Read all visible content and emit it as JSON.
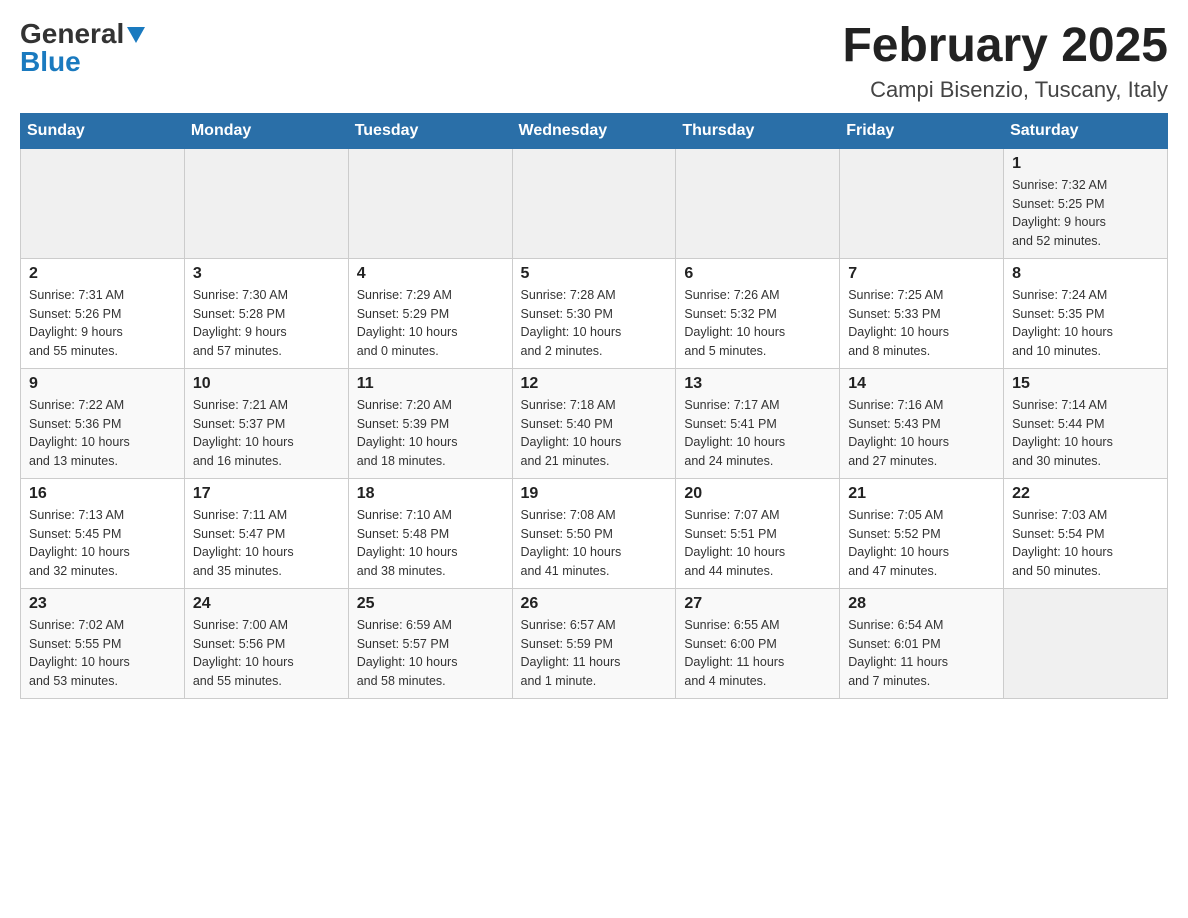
{
  "logo": {
    "general": "General",
    "blue": "Blue",
    "triangle": "▲"
  },
  "header": {
    "month_title": "February 2025",
    "location": "Campi Bisenzio, Tuscany, Italy"
  },
  "weekdays": [
    "Sunday",
    "Monday",
    "Tuesday",
    "Wednesday",
    "Thursday",
    "Friday",
    "Saturday"
  ],
  "weeks": [
    {
      "days": [
        {
          "number": "",
          "info": ""
        },
        {
          "number": "",
          "info": ""
        },
        {
          "number": "",
          "info": ""
        },
        {
          "number": "",
          "info": ""
        },
        {
          "number": "",
          "info": ""
        },
        {
          "number": "",
          "info": ""
        },
        {
          "number": "1",
          "info": "Sunrise: 7:32 AM\nSunset: 5:25 PM\nDaylight: 9 hours\nand 52 minutes."
        }
      ]
    },
    {
      "days": [
        {
          "number": "2",
          "info": "Sunrise: 7:31 AM\nSunset: 5:26 PM\nDaylight: 9 hours\nand 55 minutes."
        },
        {
          "number": "3",
          "info": "Sunrise: 7:30 AM\nSunset: 5:28 PM\nDaylight: 9 hours\nand 57 minutes."
        },
        {
          "number": "4",
          "info": "Sunrise: 7:29 AM\nSunset: 5:29 PM\nDaylight: 10 hours\nand 0 minutes."
        },
        {
          "number": "5",
          "info": "Sunrise: 7:28 AM\nSunset: 5:30 PM\nDaylight: 10 hours\nand 2 minutes."
        },
        {
          "number": "6",
          "info": "Sunrise: 7:26 AM\nSunset: 5:32 PM\nDaylight: 10 hours\nand 5 minutes."
        },
        {
          "number": "7",
          "info": "Sunrise: 7:25 AM\nSunset: 5:33 PM\nDaylight: 10 hours\nand 8 minutes."
        },
        {
          "number": "8",
          "info": "Sunrise: 7:24 AM\nSunset: 5:35 PM\nDaylight: 10 hours\nand 10 minutes."
        }
      ]
    },
    {
      "days": [
        {
          "number": "9",
          "info": "Sunrise: 7:22 AM\nSunset: 5:36 PM\nDaylight: 10 hours\nand 13 minutes."
        },
        {
          "number": "10",
          "info": "Sunrise: 7:21 AM\nSunset: 5:37 PM\nDaylight: 10 hours\nand 16 minutes."
        },
        {
          "number": "11",
          "info": "Sunrise: 7:20 AM\nSunset: 5:39 PM\nDaylight: 10 hours\nand 18 minutes."
        },
        {
          "number": "12",
          "info": "Sunrise: 7:18 AM\nSunset: 5:40 PM\nDaylight: 10 hours\nand 21 minutes."
        },
        {
          "number": "13",
          "info": "Sunrise: 7:17 AM\nSunset: 5:41 PM\nDaylight: 10 hours\nand 24 minutes."
        },
        {
          "number": "14",
          "info": "Sunrise: 7:16 AM\nSunset: 5:43 PM\nDaylight: 10 hours\nand 27 minutes."
        },
        {
          "number": "15",
          "info": "Sunrise: 7:14 AM\nSunset: 5:44 PM\nDaylight: 10 hours\nand 30 minutes."
        }
      ]
    },
    {
      "days": [
        {
          "number": "16",
          "info": "Sunrise: 7:13 AM\nSunset: 5:45 PM\nDaylight: 10 hours\nand 32 minutes."
        },
        {
          "number": "17",
          "info": "Sunrise: 7:11 AM\nSunset: 5:47 PM\nDaylight: 10 hours\nand 35 minutes."
        },
        {
          "number": "18",
          "info": "Sunrise: 7:10 AM\nSunset: 5:48 PM\nDaylight: 10 hours\nand 38 minutes."
        },
        {
          "number": "19",
          "info": "Sunrise: 7:08 AM\nSunset: 5:50 PM\nDaylight: 10 hours\nand 41 minutes."
        },
        {
          "number": "20",
          "info": "Sunrise: 7:07 AM\nSunset: 5:51 PM\nDaylight: 10 hours\nand 44 minutes."
        },
        {
          "number": "21",
          "info": "Sunrise: 7:05 AM\nSunset: 5:52 PM\nDaylight: 10 hours\nand 47 minutes."
        },
        {
          "number": "22",
          "info": "Sunrise: 7:03 AM\nSunset: 5:54 PM\nDaylight: 10 hours\nand 50 minutes."
        }
      ]
    },
    {
      "days": [
        {
          "number": "23",
          "info": "Sunrise: 7:02 AM\nSunset: 5:55 PM\nDaylight: 10 hours\nand 53 minutes."
        },
        {
          "number": "24",
          "info": "Sunrise: 7:00 AM\nSunset: 5:56 PM\nDaylight: 10 hours\nand 55 minutes."
        },
        {
          "number": "25",
          "info": "Sunrise: 6:59 AM\nSunset: 5:57 PM\nDaylight: 10 hours\nand 58 minutes."
        },
        {
          "number": "26",
          "info": "Sunrise: 6:57 AM\nSunset: 5:59 PM\nDaylight: 11 hours\nand 1 minute."
        },
        {
          "number": "27",
          "info": "Sunrise: 6:55 AM\nSunset: 6:00 PM\nDaylight: 11 hours\nand 4 minutes."
        },
        {
          "number": "28",
          "info": "Sunrise: 6:54 AM\nSunset: 6:01 PM\nDaylight: 11 hours\nand 7 minutes."
        },
        {
          "number": "",
          "info": ""
        }
      ]
    }
  ]
}
